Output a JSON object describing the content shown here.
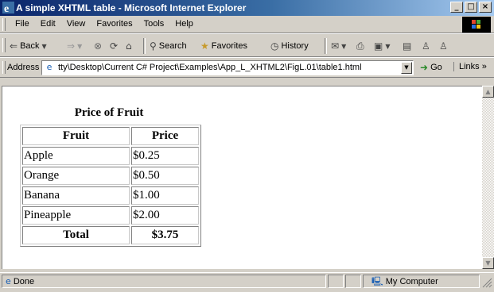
{
  "window": {
    "title": "A simple XHTML table - Microsoft Internet Explorer",
    "min": "_",
    "max": "□",
    "close": "×"
  },
  "menu": [
    "File",
    "Edit",
    "View",
    "Favorites",
    "Tools",
    "Help"
  ],
  "toolbar": {
    "back": "Back",
    "search": "Search",
    "favorites": "Favorites",
    "history": "History"
  },
  "address": {
    "label": "Address",
    "url": "tty\\Desktop\\Current C# Project\\Examples\\App_L_XHTML2\\FigL.01\\table1.html",
    "go": "Go",
    "links": "Links »"
  },
  "page": {
    "caption": "Price of Fruit",
    "headers": [
      "Fruit",
      "Price"
    ],
    "rows": [
      [
        "Apple",
        "$0.25"
      ],
      [
        "Orange",
        "$0.50"
      ],
      [
        "Banana",
        "$1.00"
      ],
      [
        "Pineapple",
        "$2.00"
      ]
    ],
    "footer": [
      "Total",
      "$3.75"
    ]
  },
  "status": {
    "text": "Done",
    "zone": "My Computer"
  },
  "colors": {
    "titlebar_start": "#0a246a",
    "titlebar_end": "#a6caf0",
    "chrome": "#d4d0c8"
  }
}
